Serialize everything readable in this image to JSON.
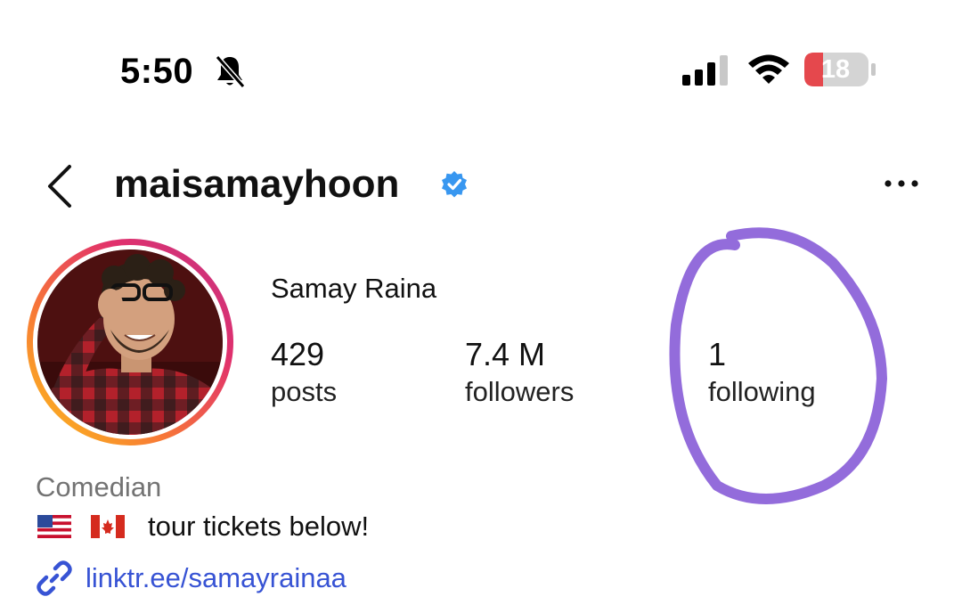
{
  "status_bar": {
    "time": "5:50",
    "icons": [
      "bell-muted-icon",
      "cellular-signal-icon",
      "wifi-icon",
      "battery-icon"
    ],
    "battery_level": "18",
    "battery_color": "#e5484d"
  },
  "header": {
    "username": "maisamayhoon",
    "verified": true,
    "verified_color": "#3897f0",
    "icons": [
      "back-chevron-icon",
      "verified-badge-icon",
      "more-options-icon"
    ]
  },
  "profile": {
    "full_name": "Samay Raina",
    "stats": [
      {
        "value": "429",
        "label": "posts"
      },
      {
        "value": "7.4 M",
        "label": "followers"
      },
      {
        "value": "1",
        "label": "following"
      }
    ],
    "category": "Comedian",
    "bio": {
      "flags": [
        "us-flag",
        "canada-flag"
      ],
      "text": "tour tickets below!"
    },
    "link": "linktr.ee/samayrainaa",
    "link_color": "#3753d4"
  },
  "annotation": {
    "type": "hand-drawn circle",
    "color": "#8a5fd8",
    "target": "following"
  }
}
